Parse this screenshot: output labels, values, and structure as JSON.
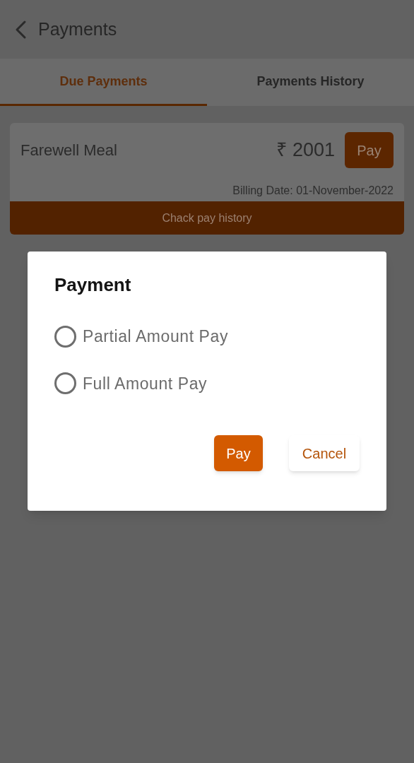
{
  "header": {
    "title": "Payments"
  },
  "tabs": [
    {
      "label": "Due Payments",
      "selected": true
    },
    {
      "label": "Payments History",
      "selected": false
    }
  ],
  "payments": [
    {
      "name": "Farewell Meal",
      "amount": "₹ 2001",
      "pay_button": "Pay",
      "billing_date": "Billing Date: 01-November-2022",
      "history_button": "Chack pay history"
    }
  ],
  "dialog": {
    "title": "Payment",
    "options": [
      {
        "label": "Partial Amount Pay",
        "selected": false
      },
      {
        "label": "Full Amount Pay",
        "selected": false
      }
    ],
    "buttons": [
      {
        "label": "Pay",
        "kind": "primary"
      },
      {
        "label": "Cancel",
        "kind": "secondary"
      }
    ]
  }
}
